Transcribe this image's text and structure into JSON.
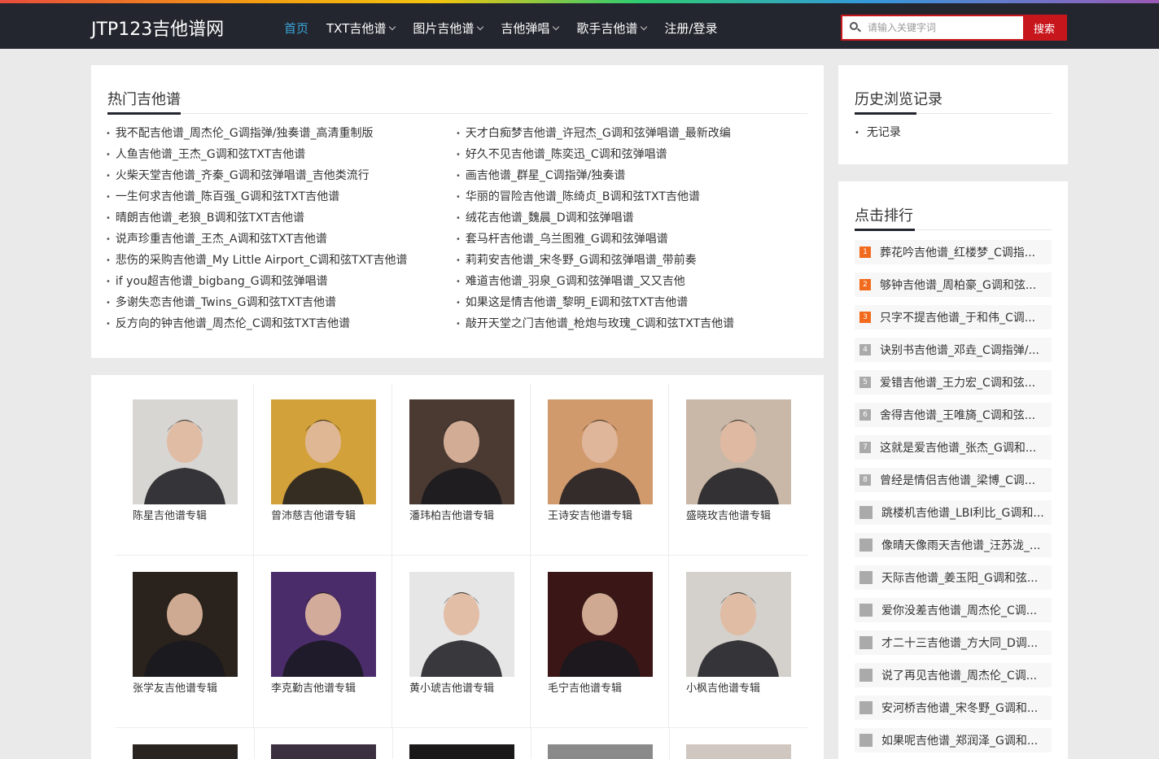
{
  "site": {
    "logo": "JTP123吉他谱网"
  },
  "nav": [
    {
      "label": "首页",
      "active": true,
      "dropdown": false
    },
    {
      "label": "TXT吉他谱",
      "active": false,
      "dropdown": true
    },
    {
      "label": "图片吉他谱",
      "active": false,
      "dropdown": true
    },
    {
      "label": "吉他弹唱",
      "active": false,
      "dropdown": true
    },
    {
      "label": "歌手吉他谱",
      "active": false,
      "dropdown": true
    },
    {
      "label": "注册/登录",
      "active": false,
      "dropdown": false
    }
  ],
  "search": {
    "placeholder": "请输入关键字词",
    "button": "搜索",
    "icon": "search-icon"
  },
  "colors": {
    "nav_bg": "#23262e",
    "accent_blue": "#3aa7dc",
    "search_red": "#c8161d",
    "rank_hot": "#f26b1d"
  },
  "hot": {
    "title": "热门吉他谱",
    "left": [
      "我不配吉他谱_周杰伦_G调指弹/独奏谱_高清重制版",
      "人鱼吉他谱_王杰_G调和弦TXT吉他谱",
      "火柴天堂吉他谱_齐秦_G调和弦弹唱谱_吉他类流行",
      "一生何求吉他谱_陈百强_G调和弦TXT吉他谱",
      "晴朗吉他谱_老狼_B调和弦TXT吉他谱",
      "说声珍重吉他谱_王杰_A调和弦TXT吉他谱",
      "悲伤的采购吉他谱_My Little Airport_C调和弦TXT吉他谱",
      "if you超吉他谱_bigbang_G调和弦弹唱谱",
      "多谢失恋吉他谱_Twins_G调和弦TXT吉他谱",
      "反方向的钟吉他谱_周杰伦_C调和弦TXT吉他谱"
    ],
    "right": [
      "天才白痴梦吉他谱_许冠杰_G调和弦弹唱谱_最新改编",
      "好久不见吉他谱_陈奕迅_C调和弦弹唱谱",
      "画吉他谱_群星_C调指弹/独奏谱",
      "华丽的冒险吉他谱_陈绮贞_B调和弦TXT吉他谱",
      "绒花吉他谱_魏晨_D调和弦弹唱谱",
      "套马杆吉他谱_乌兰图雅_G调和弦弹唱谱",
      "莉莉安吉他谱_宋冬野_G调和弦弹唱谱_带前奏",
      "难道吉他谱_羽泉_G调和弦弹唱谱_又又吉他",
      "如果这是情吉他谱_黎明_E调和弦TXT吉他谱",
      "敲开天堂之门吉他谱_枪炮与玫瑰_C调和弦TXT吉他谱"
    ]
  },
  "singers": [
    {
      "name": "陈星吉他谱专辑",
      "bg": "#d8d6d2"
    },
    {
      "name": "曾沛慈吉他谱专辑",
      "bg": "#d3a13a"
    },
    {
      "name": "潘玮柏吉他谱专辑",
      "bg": "#4a3a32"
    },
    {
      "name": "王诗安吉他谱专辑",
      "bg": "#d19a6c"
    },
    {
      "name": "盛晓玫吉他谱专辑",
      "bg": "#c9b8a8"
    },
    {
      "name": "张学友吉他谱专辑",
      "bg": "#2a221c"
    },
    {
      "name": "李克勤吉他谱专辑",
      "bg": "#4b2c6b"
    },
    {
      "name": "黄小琥吉他谱专辑",
      "bg": "#e6e6e6"
    },
    {
      "name": "毛宁吉他谱专辑",
      "bg": "#3b1616"
    },
    {
      "name": "小枫吉他谱专辑",
      "bg": "#d4d0cb"
    }
  ],
  "history": {
    "title": "历史浏览记录",
    "empty": "无记录"
  },
  "rank": {
    "title": "点击排行",
    "items": [
      {
        "num": "1",
        "text": "葬花吟吉他谱_红楼梦_C调指..."
      },
      {
        "num": "2",
        "text": "够钟吉他谱_周柏豪_G调和弦..."
      },
      {
        "num": "3",
        "text": "只字不提吉他谱_于和伟_C调..."
      },
      {
        "num": "4",
        "text": "诀别书吉他谱_邓垚_C调指弹/..."
      },
      {
        "num": "5",
        "text": "爱错吉他谱_王力宏_C调和弦..."
      },
      {
        "num": "6",
        "text": "舍得吉他谱_王唯旖_C调和弦..."
      },
      {
        "num": "7",
        "text": "这就是爱吉他谱_张杰_G调和..."
      },
      {
        "num": "8",
        "text": "曾经是情侣吉他谱_梁博_C调..."
      },
      {
        "num": "",
        "text": "跳楼机吉他谱_LBI利比_G调和..."
      },
      {
        "num": "",
        "text": "像晴天像雨天吉他谱_汪苏泷_..."
      },
      {
        "num": "",
        "text": "天际吉他谱_姜玉阳_G调和弦..."
      },
      {
        "num": "",
        "text": "爱你没差吉他谱_周杰伦_C调..."
      },
      {
        "num": "",
        "text": "才二十三吉他谱_方大同_D调..."
      },
      {
        "num": "",
        "text": "说了再见吉他谱_周杰伦_C调..."
      },
      {
        "num": "",
        "text": "安河桥吉他谱_宋冬野_G调和..."
      },
      {
        "num": "",
        "text": "如果呢吉他谱_郑润泽_G调和..."
      }
    ]
  }
}
